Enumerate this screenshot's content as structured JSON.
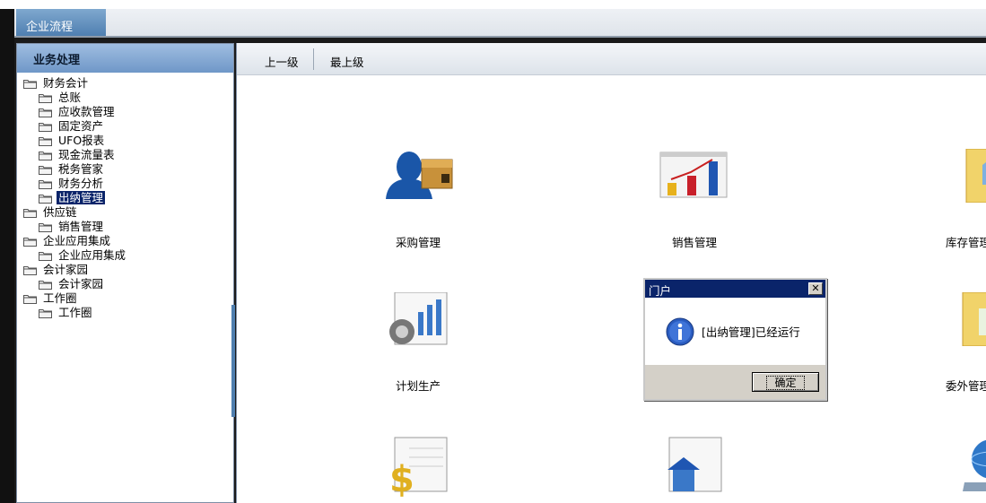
{
  "window": {
    "tab_label": "企业流程"
  },
  "sidebar": {
    "header": "业务处理",
    "tree": [
      {
        "label": "财务会计",
        "level": 0,
        "icon": "folder-icon"
      },
      {
        "label": "总账",
        "level": 1,
        "icon": "folder-icon"
      },
      {
        "label": "应收款管理",
        "level": 1,
        "icon": "folder-icon"
      },
      {
        "label": "固定资产",
        "level": 1,
        "icon": "folder-icon"
      },
      {
        "label": "UFO报表",
        "level": 1,
        "icon": "folder-icon"
      },
      {
        "label": "现金流量表",
        "level": 1,
        "icon": "folder-icon"
      },
      {
        "label": "税务管家",
        "level": 1,
        "icon": "folder-icon"
      },
      {
        "label": "财务分析",
        "level": 1,
        "icon": "folder-icon"
      },
      {
        "label": "出纳管理",
        "level": 1,
        "icon": "folder-icon",
        "selected": true
      },
      {
        "label": "供应链",
        "level": 0,
        "icon": "folder-icon"
      },
      {
        "label": "销售管理",
        "level": 1,
        "icon": "folder-icon"
      },
      {
        "label": "企业应用集成",
        "level": 0,
        "icon": "folder-icon"
      },
      {
        "label": "企业应用集成",
        "level": 1,
        "icon": "folder-icon"
      },
      {
        "label": "会计家园",
        "level": 0,
        "icon": "folder-icon"
      },
      {
        "label": "会计家园",
        "level": 1,
        "icon": "folder-icon"
      },
      {
        "label": "工作圈",
        "level": 0,
        "icon": "folder-icon"
      },
      {
        "label": "工作圈",
        "level": 1,
        "icon": "folder-icon"
      }
    ]
  },
  "toolbar": {
    "up_label": "上一级",
    "top_label": "最上级"
  },
  "apps": [
    {
      "label": "采购管理",
      "icon": "purchase-person-box-icon"
    },
    {
      "label": "销售管理",
      "icon": "sales-bar-chart-icon"
    },
    {
      "label": "库存管理",
      "icon": "inventory-house-folder-icon"
    },
    {
      "label": "计划生产",
      "icon": "production-gear-chart-icon"
    },
    {
      "label": "委外管理",
      "icon": "outsourcing-folder-icon"
    },
    {
      "label": "",
      "icon": "dollar-document-icon"
    },
    {
      "label": "",
      "icon": "house-document-icon"
    },
    {
      "label": "",
      "icon": "globe-device-icon"
    }
  ],
  "dialog": {
    "title": "门户",
    "message": "[出纳管理]已经运行",
    "ok_label": "确定",
    "close_glyph": "✕"
  },
  "colors": {
    "selection": "#0a246a",
    "header_blue": "#6f97c8",
    "dialog_title": "#0a246a"
  }
}
